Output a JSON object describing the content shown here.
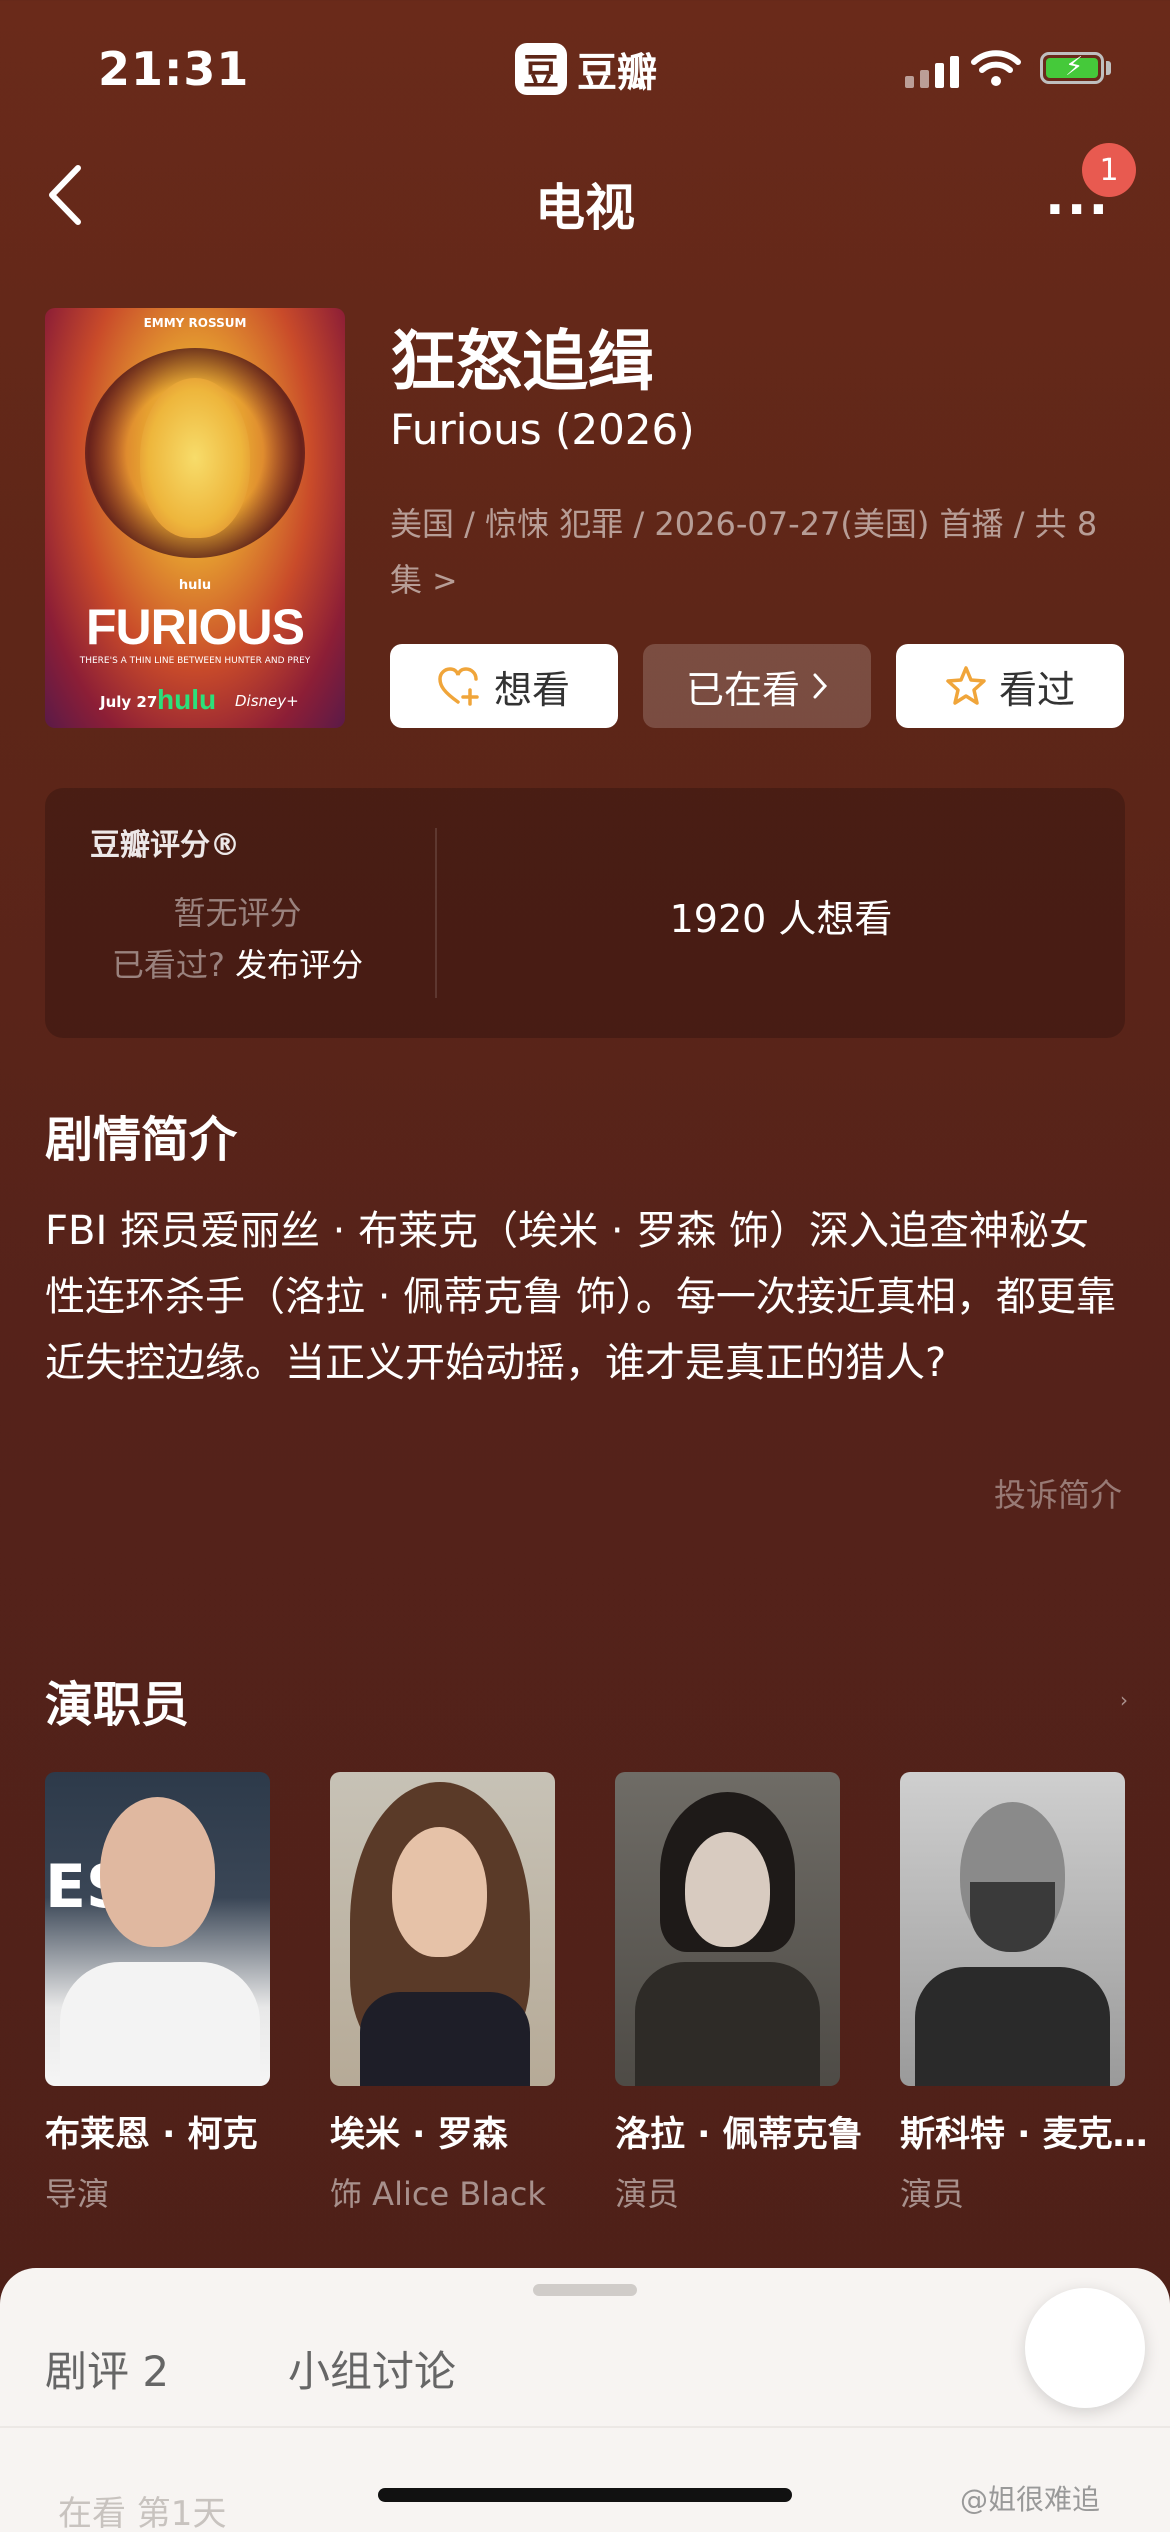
{
  "status_bar": {
    "time": "21:31",
    "app_name": "豆瓣",
    "app_logo_char": "豆"
  },
  "nav": {
    "title": "电视",
    "more_icon": "more-dots-icon",
    "badge_count": "1"
  },
  "show": {
    "title_cn": "狂怒追缉",
    "title_en": "Furious (2026)",
    "meta": "美国 / 惊悚 犯罪 / 2026-07-27(美国) 首播 / 共 8 集",
    "poster": {
      "actor_text": "EMMY ROSSUM",
      "network_small": "hulu",
      "title_text": "FURIOUS",
      "tagline": "THERE'S A THIN LINE BETWEEN HUNTER AND PREY",
      "date_text": "July 27",
      "network_text": "hulu",
      "partner_text": "Disney+"
    }
  },
  "actions": {
    "want": "想看",
    "watching": "已在看",
    "watched": "看过"
  },
  "rating": {
    "label": "豆瓣评分®",
    "none_text": "暂无评分",
    "watched_prompt": "已看过?",
    "rate_action": "发布评分",
    "wish_count_text": "1920 人想看"
  },
  "synopsis": {
    "heading": "剧情简介",
    "text": "FBI 探员爱丽丝 · 布莱克（埃米 · 罗森 饰）深入追查神秘女性连环杀手（洛拉 · 佩蒂克鲁 饰）。每一次接近真相，都更靠近失控边缘。当正义开始动摇，谁才是真正的猎人?",
    "report_link": "投诉简介"
  },
  "cast": {
    "heading": "演职员",
    "members": [
      {
        "name": "布莱恩 · 柯克",
        "role": "导演"
      },
      {
        "name": "埃米 · 罗森",
        "role": "饰 Alice Black"
      },
      {
        "name": "洛拉 · 佩蒂克鲁",
        "role": "演员"
      },
      {
        "name": "斯科特 · 麦克...",
        "role": "演员"
      }
    ]
  },
  "bottom_sheet": {
    "tabs": [
      "剧评 2",
      "小组讨论"
    ],
    "peek_text": "在看 第1天"
  },
  "watermark": "@姐很难追",
  "colors": {
    "background": "#5e2618",
    "accent": "#f0a53a",
    "badge": "#e85a50"
  }
}
